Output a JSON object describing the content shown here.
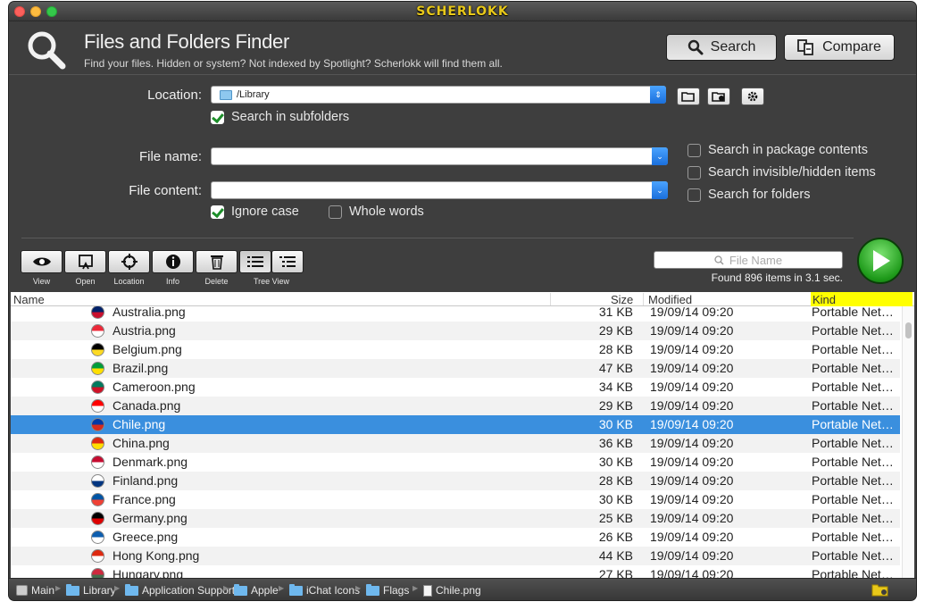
{
  "app": {
    "title": "SCHERLOKK"
  },
  "header": {
    "title": "Files and Folders Finder",
    "subtitle": "Find your files. Hidden or system? Not indexed by Spotlight? Scherlokk will find them all.",
    "search_label": "Search",
    "compare_label": "Compare"
  },
  "form": {
    "location_label": "Location:",
    "location_value": "/Library",
    "subfolders_label": "Search in subfolders",
    "filename_label": "File name:",
    "filecontent_label": "File content:",
    "ignore_case_label": "Ignore case",
    "whole_words_label": "Whole words",
    "package_label": "Search in package contents",
    "invisible_label": "Search invisible/hidden items",
    "folders_label": "Search for folders"
  },
  "toolbar": {
    "view": "View",
    "open": "Open",
    "location": "Location",
    "info": "Info",
    "delete": "Delete",
    "tree_view": "Tree View",
    "filter_placeholder": "File Name",
    "found_text": "Found 896 items in 3.1 sec."
  },
  "table": {
    "headers": {
      "name": "Name",
      "size": "Size",
      "modified": "Modified",
      "kind": "Kind"
    },
    "rows": [
      {
        "name": "Australia.png",
        "size": "31 KB",
        "modified": "19/09/14 09:20",
        "kind": "Portable Network Graphics image",
        "colors": [
          "#012169",
          "#c8102e"
        ]
      },
      {
        "name": "Austria.png",
        "size": "29 KB",
        "modified": "19/09/14 09:20",
        "kind": "Portable Network Graphics image",
        "colors": [
          "#ed2939",
          "#ffffff"
        ]
      },
      {
        "name": "Belgium.png",
        "size": "28 KB",
        "modified": "19/09/14 09:20",
        "kind": "Portable Network Graphics image",
        "colors": [
          "#000000",
          "#fdda24"
        ]
      },
      {
        "name": "Brazil.png",
        "size": "47 KB",
        "modified": "19/09/14 09:20",
        "kind": "Portable Network Graphics image",
        "colors": [
          "#009c3b",
          "#ffdf00"
        ]
      },
      {
        "name": "Cameroon.png",
        "size": "34 KB",
        "modified": "19/09/14 09:20",
        "kind": "Portable Network Graphics image",
        "colors": [
          "#007a5e",
          "#ce1126"
        ]
      },
      {
        "name": "Canada.png",
        "size": "29 KB",
        "modified": "19/09/14 09:20",
        "kind": "Portable Network Graphics image",
        "colors": [
          "#ff0000",
          "#ffffff"
        ]
      },
      {
        "name": "Chile.png",
        "size": "30 KB",
        "modified": "19/09/14 09:20",
        "kind": "Portable Network Graphics image",
        "colors": [
          "#0039a6",
          "#d52b1e"
        ],
        "selected": true
      },
      {
        "name": "China.png",
        "size": "36 KB",
        "modified": "19/09/14 09:20",
        "kind": "Portable Network Graphics image",
        "colors": [
          "#de2910",
          "#ffde00"
        ]
      },
      {
        "name": "Denmark.png",
        "size": "30 KB",
        "modified": "19/09/14 09:20",
        "kind": "Portable Network Graphics image",
        "colors": [
          "#c60c30",
          "#ffffff"
        ]
      },
      {
        "name": "Finland.png",
        "size": "28 KB",
        "modified": "19/09/14 09:20",
        "kind": "Portable Network Graphics image",
        "colors": [
          "#ffffff",
          "#003580"
        ]
      },
      {
        "name": "France.png",
        "size": "30 KB",
        "modified": "19/09/14 09:20",
        "kind": "Portable Network Graphics image",
        "colors": [
          "#0055a4",
          "#ef4135"
        ]
      },
      {
        "name": "Germany.png",
        "size": "25 KB",
        "modified": "19/09/14 09:20",
        "kind": "Portable Network Graphics image",
        "colors": [
          "#000000",
          "#dd0000"
        ]
      },
      {
        "name": "Greece.png",
        "size": "26 KB",
        "modified": "19/09/14 09:20",
        "kind": "Portable Network Graphics image",
        "colors": [
          "#0d5eaf",
          "#ffffff"
        ]
      },
      {
        "name": "Hong Kong.png",
        "size": "44 KB",
        "modified": "19/09/14 09:20",
        "kind": "Portable Network Graphics image",
        "colors": [
          "#de2910",
          "#ffffff"
        ]
      },
      {
        "name": "Hungary.png",
        "size": "27 KB",
        "modified": "19/09/14 09:20",
        "kind": "Portable Network Graphics image",
        "colors": [
          "#cd2a3e",
          "#436f4d"
        ]
      }
    ]
  },
  "statusbar": {
    "crumbs": [
      "Main",
      "Library",
      "Application Support",
      "Apple",
      "iChat Icons",
      "Flags",
      "Chile.png"
    ]
  }
}
